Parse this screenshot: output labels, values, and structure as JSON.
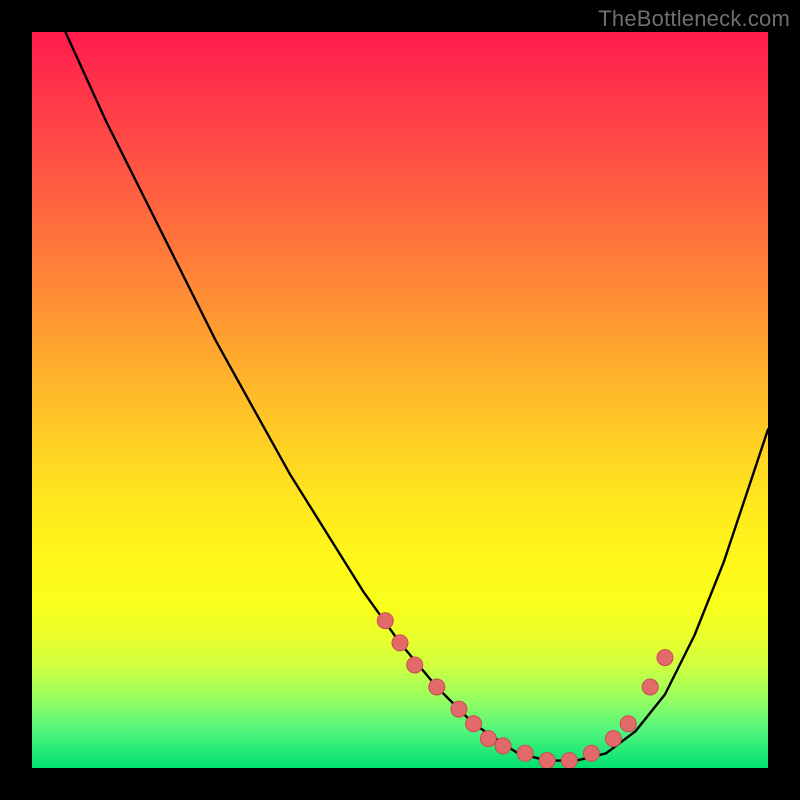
{
  "watermark": "TheBottleneck.com",
  "colors": {
    "dot_fill": "#e36a6a",
    "dot_stroke": "#ca4d4d",
    "curve_stroke": "#000000"
  },
  "chart_data": {
    "type": "line",
    "title": "",
    "xlabel": "",
    "ylabel": "",
    "xlim": [
      0,
      100
    ],
    "ylim": [
      0,
      100
    ],
    "grid": false,
    "series": [
      {
        "name": "bottleneck-curve",
        "x": [
          0,
          5,
          10,
          15,
          20,
          25,
          30,
          35,
          40,
          45,
          50,
          55,
          60,
          63,
          66,
          70,
          74,
          78,
          82,
          86,
          90,
          94,
          98,
          100
        ],
        "values": [
          110,
          99,
          88,
          78,
          68,
          58,
          49,
          40,
          32,
          24,
          17,
          11,
          6,
          4,
          2,
          1,
          1,
          2,
          5,
          10,
          18,
          28,
          40,
          46
        ]
      }
    ],
    "dots": {
      "name": "highlighted-points",
      "x": [
        48,
        50,
        52,
        55,
        58,
        60,
        62,
        64,
        67,
        70,
        73,
        76,
        79,
        81,
        84,
        86
      ],
      "values": [
        20,
        17,
        14,
        11,
        8,
        6,
        4,
        3,
        2,
        1,
        1,
        2,
        4,
        6,
        11,
        15
      ]
    }
  }
}
